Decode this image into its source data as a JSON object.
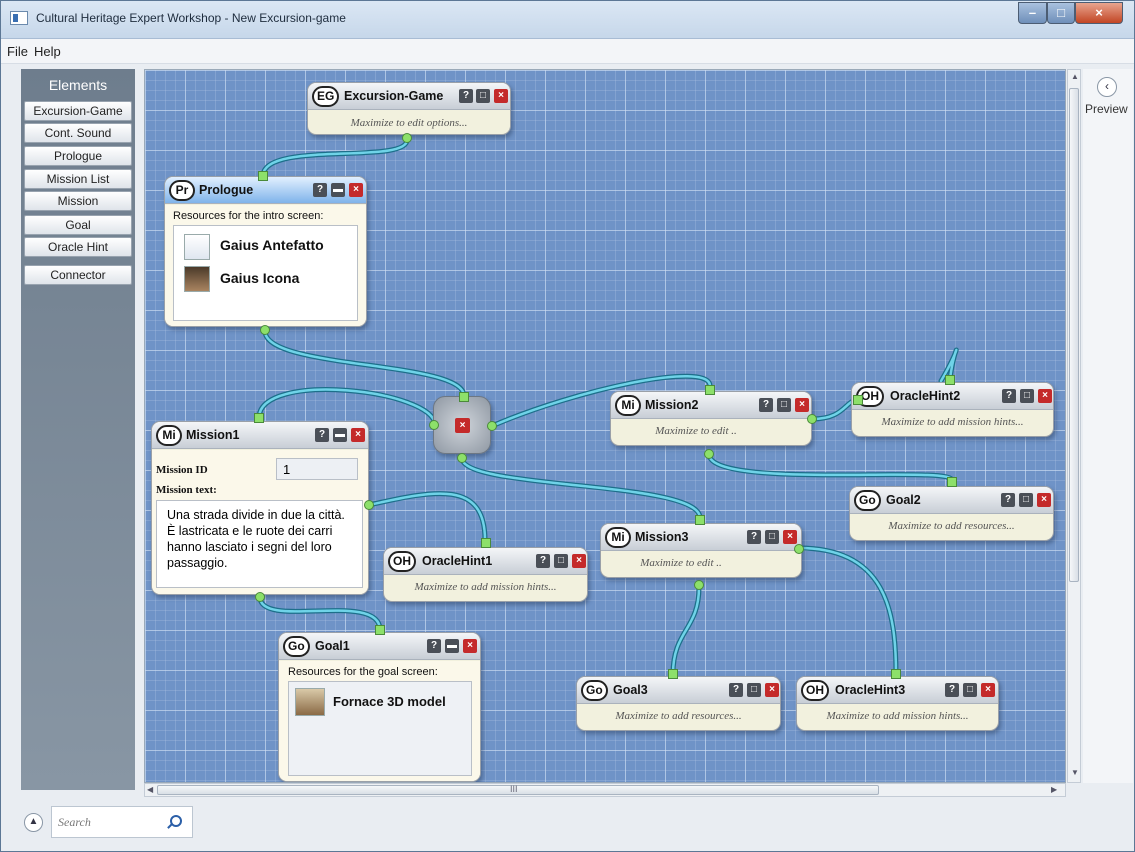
{
  "window": {
    "title": "Cultural Heritage Expert Workshop - New Excursion-game"
  },
  "menu": [
    "File",
    "Help"
  ],
  "sidebar": {
    "heading": "Elements",
    "items": [
      "Excursion-Game",
      "Cont. Sound",
      "Prologue",
      "Mission List",
      "Mission",
      "Goal",
      "Oracle Hint",
      "Connector"
    ]
  },
  "right_panel": {
    "label": "Preview"
  },
  "search": {
    "placeholder": "Search"
  },
  "scroll": {
    "h_grip": "III"
  },
  "node_buttons": {
    "help": "?",
    "max": "□",
    "close": "×"
  },
  "nodes": {
    "excursion": {
      "badge": "EG",
      "title": "Excursion-Game",
      "subtitle": "Maximize to edit options..."
    },
    "prologue": {
      "badge": "Pr",
      "title": "Prologue",
      "label": "Resources for the intro screen:",
      "resources": [
        "Gaius Antefatto",
        "Gaius Icona"
      ]
    },
    "mission1": {
      "badge": "Mi",
      "title": "Mission1",
      "id_label": "Mission ID",
      "id_value": "1",
      "text_label": "Mission text:",
      "text": "Una strada divide in due la città. È lastricata e le ruote dei carri hanno lasciato i segni del loro passaggio."
    },
    "mission2": {
      "badge": "Mi",
      "title": "Mission2",
      "subtitle": "Maximize to edit .."
    },
    "mission3": {
      "badge": "Mi",
      "title": "Mission3",
      "subtitle": "Maximize to edit .."
    },
    "oracle1": {
      "badge": "OH",
      "title": "OracleHint1",
      "subtitle": "Maximize to add mission hints..."
    },
    "oracle2": {
      "badge": "OH",
      "title": "OracleHint2",
      "subtitle": "Maximize to add mission hints..."
    },
    "oracle3": {
      "badge": "OH",
      "title": "OracleHint3",
      "subtitle": "Maximize to add mission hints..."
    },
    "goal1": {
      "badge": "Go",
      "title": "Goal1",
      "label": "Resources for the goal screen:",
      "resources": [
        "Fornace 3D model"
      ]
    },
    "goal2": {
      "badge": "Go",
      "title": "Goal2",
      "subtitle": "Maximize to add resources..."
    },
    "goal3": {
      "badge": "Go",
      "title": "Goal3",
      "subtitle": "Maximize to add resources..."
    }
  },
  "colors": {
    "canvas": "#6f93c7",
    "wire": "#2aa8c8",
    "port": "#8de06a",
    "close": "#c42a2a"
  }
}
